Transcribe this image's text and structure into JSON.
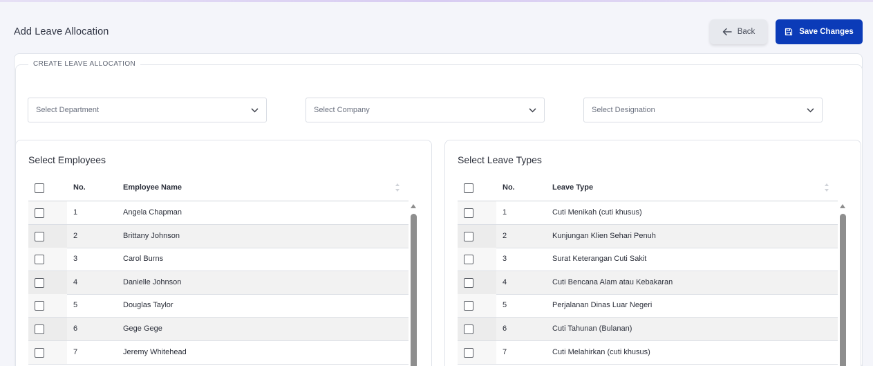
{
  "header": {
    "title": "Add Leave Allocation",
    "back_label": "Back",
    "save_label": "Save Changes"
  },
  "form": {
    "section_label": "CREATE LEAVE ALLOCATION",
    "department_placeholder": "Select Department",
    "company_placeholder": "Select Company",
    "designation_placeholder": "Select Designation"
  },
  "employees": {
    "title": "Select Employees",
    "col_no": "No.",
    "col_name": "Employee Name",
    "rows": [
      {
        "no": "1",
        "name": "Angela Chapman"
      },
      {
        "no": "2",
        "name": "Brittany Johnson"
      },
      {
        "no": "3",
        "name": "Carol Burns"
      },
      {
        "no": "4",
        "name": "Danielle Johnson"
      },
      {
        "no": "5",
        "name": "Douglas Taylor"
      },
      {
        "no": "6",
        "name": "Gege Gege"
      },
      {
        "no": "7",
        "name": "Jeremy Whitehead"
      }
    ]
  },
  "leave_types": {
    "title": "Select Leave Types",
    "col_no": "No.",
    "col_name": "Leave Type",
    "rows": [
      {
        "no": "1",
        "name": "Cuti Menikah (cuti khusus)"
      },
      {
        "no": "2",
        "name": "Kunjungan Klien Sehari Penuh"
      },
      {
        "no": "3",
        "name": "Surat Keterangan Cuti Sakit"
      },
      {
        "no": "4",
        "name": "Cuti Bencana Alam atau Kebakaran"
      },
      {
        "no": "5",
        "name": "Perjalanan Dinas Luar Negeri"
      },
      {
        "no": "6",
        "name": "Cuti Tahunan (Bulanan)"
      },
      {
        "no": "7",
        "name": "Cuti Melahirkan (cuti khusus)"
      }
    ]
  },
  "colors": {
    "primary": "#0b3bb8",
    "back_bg": "#e7e9ee",
    "page_bg": "#f4f5fa"
  },
  "icons": {
    "back": "arrow-left-icon",
    "save": "floppy-disk-icon",
    "dropdown": "chevron-down-icon",
    "sort": "sort-icon"
  }
}
